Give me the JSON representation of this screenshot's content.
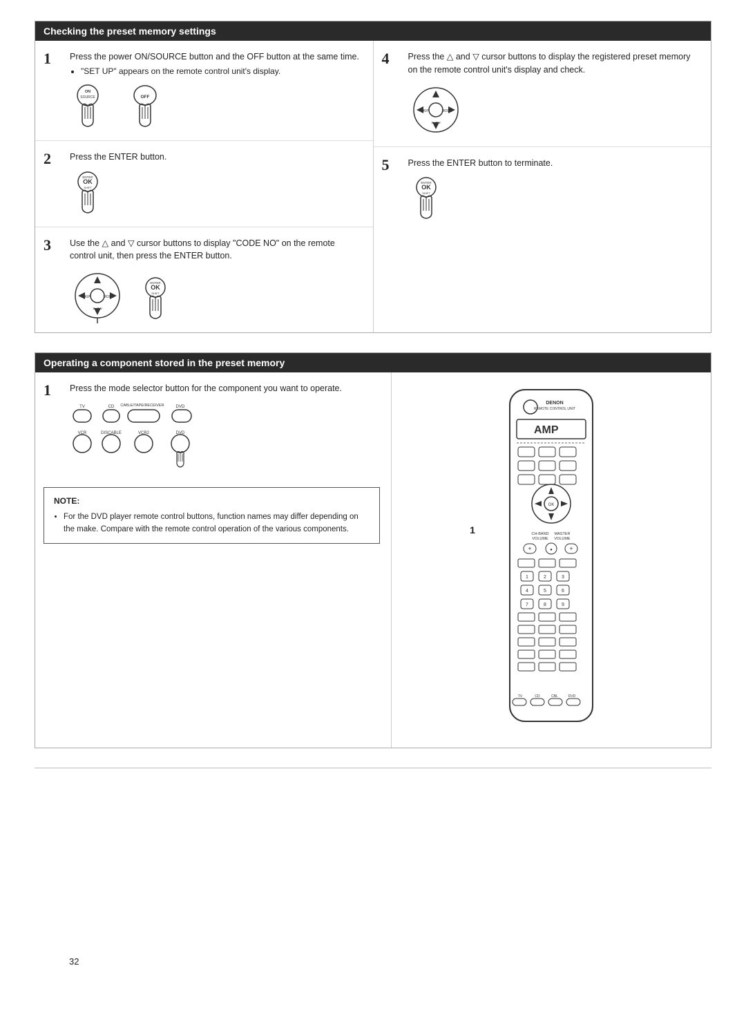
{
  "section1": {
    "title": "Checking the preset memory settings",
    "steps": [
      {
        "num": "1",
        "text": "Press the power ON/SOURCE button and the OFF button at the same time.",
        "bullets": [
          "\"SET UP\" appears on the remote control unit's display."
        ],
        "icons": [
          "on-source-button",
          "off-button-hand"
        ]
      },
      {
        "num": "2",
        "text": "Press the ENTER button.",
        "icons": [
          "enter-button-hand"
        ]
      },
      {
        "num": "3",
        "text": "Use the △ and ▽ cursor buttons to display \"CODE NO\" on the remote control unit, then press the ENTER button.",
        "icons": [
          "dpad-icon",
          "enter-button-hand"
        ]
      }
    ],
    "steps_right": [
      {
        "num": "4",
        "text": "Press the △ and ▽ cursor buttons to display the registered preset memory on the remote control unit's display and check.",
        "icons": [
          "dpad-icon"
        ]
      },
      {
        "num": "5",
        "text": "Press the ENTER button to terminate.",
        "icons": [
          "enter-button-hand"
        ]
      }
    ]
  },
  "section2": {
    "title": "Operating a component stored in the preset memory",
    "step1": {
      "num": "1",
      "text": "Press the mode selector button for the component you want to operate.",
      "icons": [
        "mode-selector-buttons"
      ]
    },
    "note": {
      "title": "NOTE:",
      "bullets": [
        "For the DVD player remote control buttons, function names may differ depending on the make.  Compare with the remote control operation of the various components."
      ]
    },
    "remote_label": "AMP",
    "remote_num": "1"
  },
  "page_number": "32"
}
